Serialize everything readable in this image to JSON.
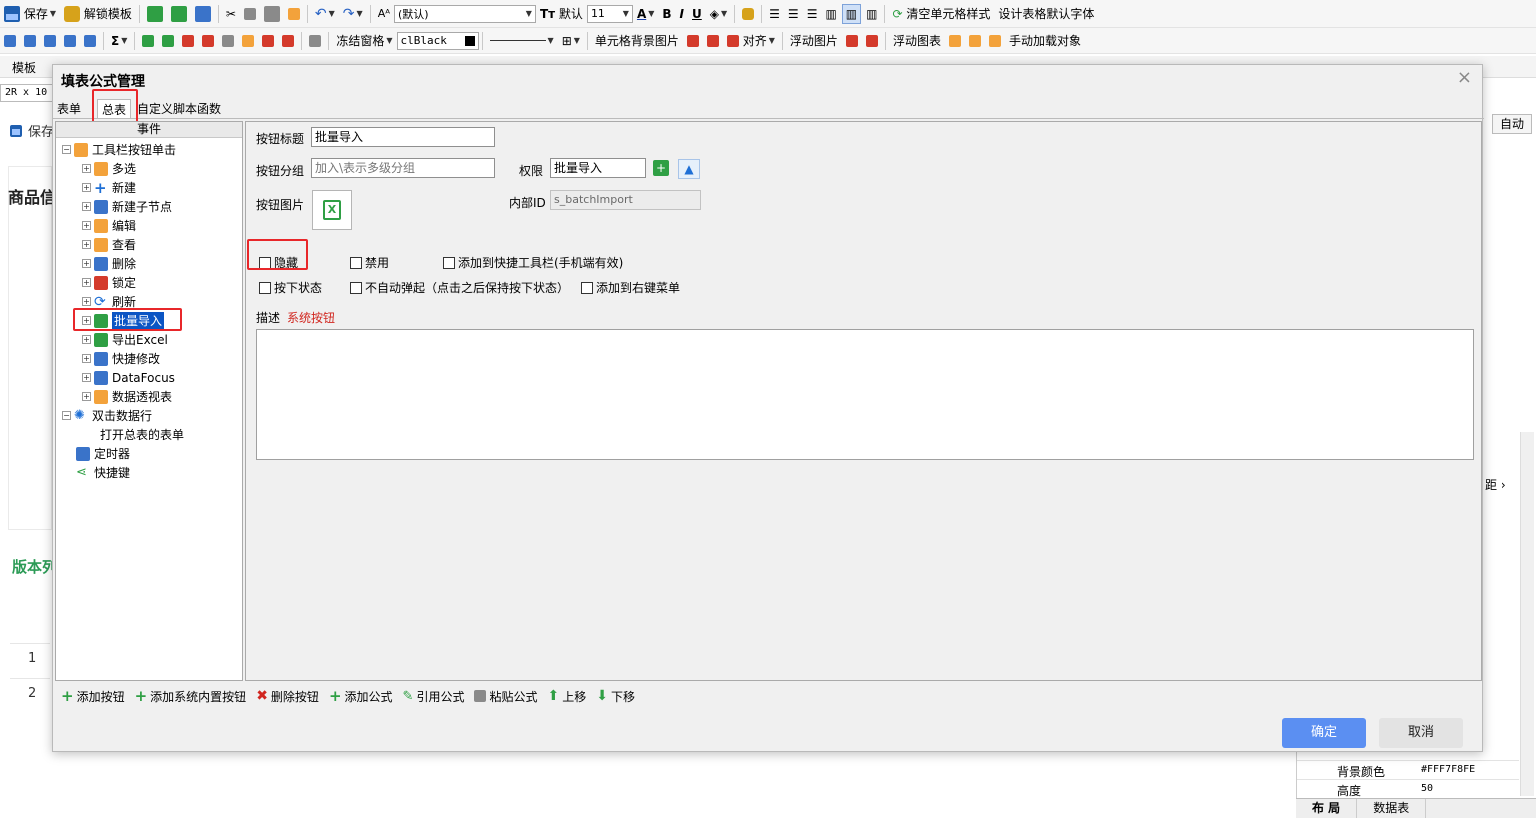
{
  "toolbar1": {
    "save": "保存",
    "unlock_template": "解锁模板",
    "font_name": "(默认)",
    "font_default": "默认",
    "font_size": "11",
    "bold": "B",
    "italic": "I",
    "underline": "U",
    "clear_cell_style": "清空单元格样式",
    "design_default_font": "设计表格默认字体"
  },
  "toolbar2": {
    "sigma": "Σ",
    "freeze_panes": "冻结窗格",
    "color_value": "clBlack",
    "cell_bg_image": "单元格背景图片",
    "align": "对齐",
    "float_image": "浮动图片",
    "float_chart": "浮动图表",
    "manual_load": "手动加载对象"
  },
  "background": {
    "template_label": "模板",
    "cell_ref": "2R x 10",
    "save_label": "保存",
    "section_title": "商品信",
    "version_title": "版本列",
    "rows": [
      "1",
      "2"
    ],
    "auto_button": "自动",
    "right_panel_arrow": "距 ›",
    "props": [
      {
        "key": "背景颜色",
        "value": "#FFF7F8FE"
      },
      {
        "key": "高度",
        "value": "50"
      }
    ],
    "bottom_tabs": [
      "布 局",
      "数据表"
    ]
  },
  "dialog": {
    "title": "填表公式管理",
    "close": "×",
    "tabs": [
      "表单",
      "总表",
      "自定义脚本函数"
    ],
    "tree_header": "事件",
    "tree": {
      "root": "工具栏按钮单击",
      "items": [
        "多选",
        "新建",
        "新建子节点",
        "编辑",
        "查看",
        "删除",
        "锁定",
        "刷新",
        "批量导入",
        "导出Excel",
        "快捷修改",
        "DataFocus",
        "数据透视表"
      ],
      "dblclick": "双击数据行",
      "dblclick_child": "打开总表的表单",
      "timer": "定时器",
      "shortcut": "快捷键"
    },
    "form": {
      "button_title_label": "按钮标题",
      "button_title_value": "批量导入",
      "button_group_label": "按钮分组",
      "button_group_placeholder": "加入\\表示多级分组",
      "permission_label": "权限",
      "permission_value": "批量导入",
      "button_image_label": "按钮图片",
      "internal_id_label": "内部ID",
      "internal_id_value": "s_batchImport",
      "checkboxes_row1": [
        "隐藏",
        "禁用",
        "添加到快捷工具栏(手机端有效)"
      ],
      "checkboxes_row2": [
        "按下状态",
        "不自动弹起（点击之后保持按下状态）",
        "添加到右键菜单"
      ],
      "desc_label": "描述",
      "desc_value": "系统按钮"
    },
    "actions": [
      "添加按钮",
      "添加系统内置按钮",
      "删除按钮",
      "添加公式",
      "引用公式",
      "粘贴公式",
      "上移",
      "下移"
    ],
    "ok": "确定",
    "cancel": "取消"
  }
}
